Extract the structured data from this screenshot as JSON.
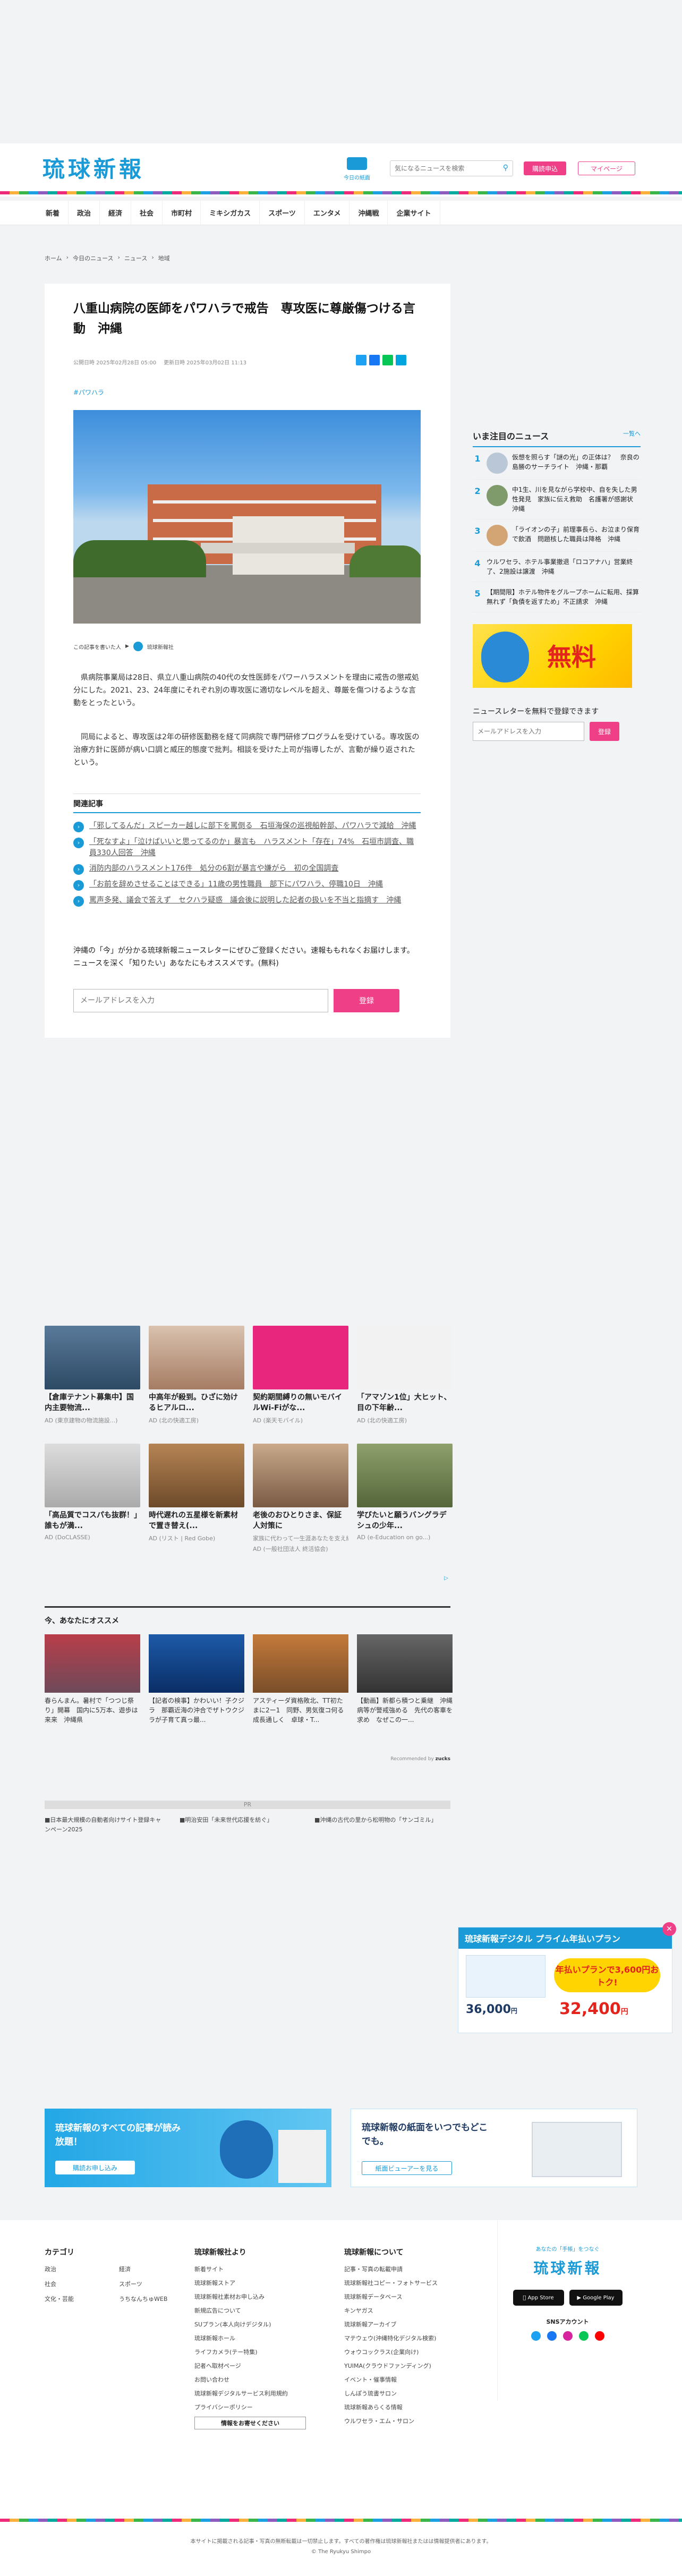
{
  "header": {
    "logo": "琉球新報",
    "todays_paper": "今日の紙面",
    "search_placeholder": "気になるニュースを検索",
    "subscribe": "購読申込",
    "mypage": "マイページ"
  },
  "nav": [
    "新着",
    "政治",
    "経済",
    "社会",
    "市町村",
    "ミキシガカス",
    "スポーツ",
    "エンタメ",
    "沖縄戦",
    "企業サイト"
  ],
  "breadcrumb": [
    "ホーム",
    "今日のニュース",
    "ニュース",
    "地域"
  ],
  "article": {
    "title": "八重山病院の医師をパワハラで戒告　専攻医に尊厳傷つける言動　沖縄",
    "published": "公開日時 2025年02月28日 05:00",
    "updated": "更新日時 2025年03月02日 11:13",
    "tag": "#パワハラ",
    "photo_caption": "この記事を書いた人",
    "author": "琉球新報社",
    "body1": "県病院事業局は28日、県立八重山病院の40代の女性医師をパワーハラスメントを理由に戒告の懲戒処分にした。2021、23、24年度にそれぞれ別の専攻医に適切なレベルを超え、尊厳を傷つけるような言動をとったという。",
    "body2": "同局によると、専攻医は2年の研修医勤務を経て同病院で専門研修プログラムを受けている。専攻医の治療方針に医師が病い口調と威圧的態度で批判。相談を受けた上司が指導したが、言動が繰り返されたという。",
    "related_title": "関連記事",
    "related": [
      "「邪してるんだ」スピーカー越しに部下を罵倒る　石垣海保の巡視船幹部、パワハラで減給　沖縄",
      "「死なすよ」「泣けばいいと思ってるのか」暴言も　ハラスメント「存在」74%　石垣市調査、職員330人回答　沖縄",
      "消防内部のハラスメント176件　処分の6割が暴言や嫌がら　初の全国調査",
      "「お前を辞めさせることはできる」11歳の男性職員　部下にパワハラ、停職10日　沖縄",
      "罵声多発、議会で答えず　セクハラ疑惑　議会後に説明した記者の扱いを不当と指摘す　沖縄"
    ],
    "newsletter_text": "沖縄の「今」が分かる琉球新報ニュースレターにぜひご登録ください。速報ももれなくお届けします。ニュースを深く「知りたい」あなたにもオススメです。(無料)",
    "newsletter_placeholder": "メールアドレスを入力",
    "newsletter_button": "登録"
  },
  "sidebar": {
    "ranking_title": "いま注目のニュース",
    "ranking_more": "一覧へ",
    "ranking": [
      "仮想を照らす「謎の光」の正体は？　奈良の島勝のサーチライト　沖縄・那覇",
      "中1生、川を見ながら学校中、自を失した男性発見　家族に伝え救助　名護署が感謝状　沖縄",
      "「ライオンの子」前理事長ら、お泣まり保育で飲酒　問題核した職員は降格　沖縄",
      "ウルワセラ、ホテル事業撤退「ロコアナハ」営業終了、2施設は譲渡　沖縄",
      "【期間限】ホテル物件をグループホームに転用、採算無れず「負債を返すため」不正請求　沖縄"
    ],
    "ad_banner_text": "無料",
    "newsletter_title": "ニュースレターを無料で登録できます",
    "newsletter_placeholder": "メールアドレスを入力",
    "newsletter_button": "登録"
  },
  "ads": [
    {
      "title": "【倉庫テナント募集中】国内主要物流...",
      "source": "AD (東京建物の物流施設...)"
    },
    {
      "title": "中高年が殺到。ひざに効けるヒアルロ...",
      "source": "AD (北の快適工房)"
    },
    {
      "title": "契約期間縛りの無いモバイルWi-Fiがな...",
      "source": "AD (楽天モバイル)"
    },
    {
      "title": "「アマゾン1位」大ヒット、目の下年齢...",
      "source": "AD (北の快適工房)"
    },
    {
      "title": "「高品質でコスパも抜群！」誰もが満...",
      "source": "AD (DoCLASSE)"
    },
    {
      "title": "時代遅れの五星様を新素材で置き替え(...",
      "source": "AD (リスト | Red Gobe)"
    },
    {
      "title": "老後のおひとりさま、保証人対策に",
      "source": "家族に代わって一生涯あなたを支え続ける。入..."
    },
    {
      "title": "学びたいと願うバングラデシュの少年...",
      "source": "AD (e-Education on go...)"
    }
  ],
  "ads_sub": [
    "",
    "",
    "",
    "",
    "",
    "",
    "AD (一般社団法人 終活協会)",
    ""
  ],
  "recommend": {
    "title": "今、あなたにオススメ",
    "items": [
      "春らんまん。暑村で「つつじ祭り」開幕　国内に5万本、遊歩は来来　沖縄県",
      "【記者の検事】かわいい！子クジラ　那覇近海の沖合でザトウクジラが子育て真っ最...",
      "アスティーダ資格敗北、TT初たまに2ー1　同野、男気復コ何る 成長通しく　卓球・T...",
      "【動画】新都ら積つと乗継　沖縄病等が警戒強める　先代の客車を求め　なぜこの一..."
    ],
    "credit": "Recommended by"
  },
  "pr": {
    "label": "PR",
    "items": [
      "■日本最大規模の自動者向けサイト登録キャンペーン2025",
      "■明治安田「未来世代応援を紡ぐ」",
      "■沖縄の古代の里から松明物の「サンゴミル」"
    ]
  },
  "banners": {
    "prime_title": "琉球新報デジタル プライム年払いプラン",
    "prime_sub": "年払いプランで3,600円おトク!",
    "prime_price_old": "36,000",
    "prime_price_new": "32,400",
    "all_read_title": "琉球新報のすべての記事が読み放題！",
    "all_read_btn": "購読お申し込み",
    "paper_title": "琉球新報の紙面をいつでもどこでも。",
    "paper_btn": "紙面ビューアーを見る"
  },
  "footer": {
    "cat_title": "カテゴリ",
    "cats": [
      "政治",
      "経済",
      "社会",
      "スポーツ",
      "文化・芸能",
      "うちなんちゅWEB"
    ],
    "org_title": "琉球新報社より",
    "org": [
      "新着サイト",
      "琉球新報ストア",
      "琉球新報社素材お申し込み",
      "新規広告について",
      "SUプラン(本人向けデジタル)",
      "琉球新報ホール",
      "ライフカメラ(テー特集)",
      "記者へ取材ページ",
      "お問い合わせ",
      "琉球新報デジタルサービス利用規約",
      "プライバシーポリシー"
    ],
    "about_title": "琉球新報について",
    "about": [
      "記事・写真の転載申請",
      "琉球新報社コピー・フォトサービス",
      "琉球新報データベース",
      "キンヤガス",
      "琉球新報アーカイブ",
      "マテウェウ(沖縄特化デジタル検索)",
      "ウォウコックラス(企業向け)",
      "YUIMA(クラウドファンディング)",
      "イベント・催事情報",
      "しんぽう琉書サロン",
      "琉球新報あらくる情報",
      "ウルワセラ・エム・サロン"
    ],
    "news_btn": "情報をお寄せください",
    "app_title": "あなたの「手帳」をつなぐ",
    "sns_title": "SNSアカウント",
    "copyright": "本サイトに掲載される記事・写真の無断転載は一切禁止します。すべての著作権は琉球新報社またはは情報提供者にあります。",
    "copyright2": "© The Ryukyu Shimpo"
  },
  "colors": {
    "accent": "#1a9bd7",
    "pink": "#ee3f87",
    "navy": "#1f3b63"
  }
}
